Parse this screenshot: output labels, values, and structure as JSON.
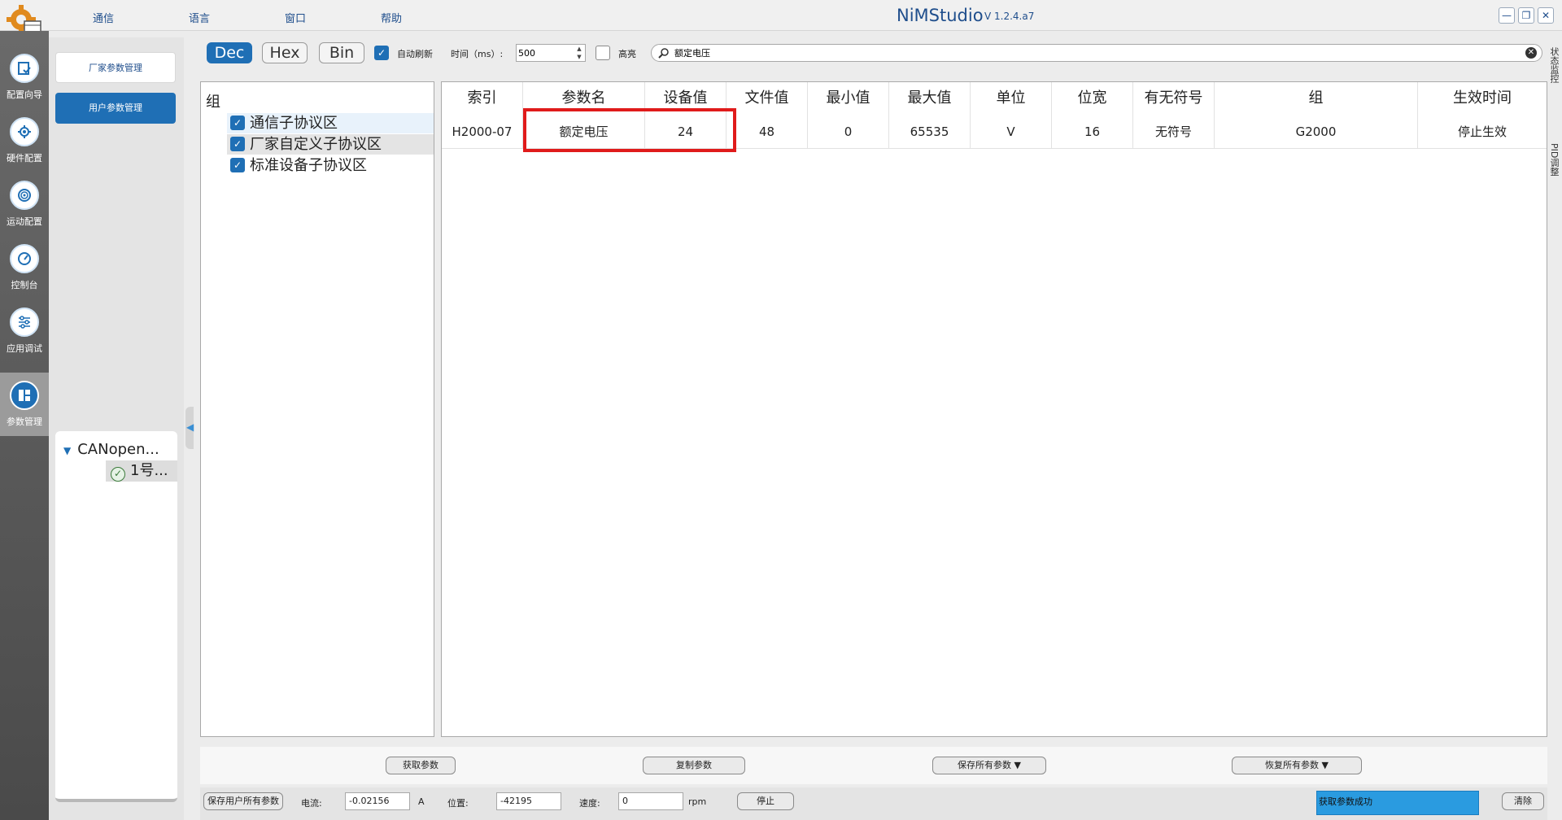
{
  "window": {
    "title": "NiMStudio",
    "version": "V 1.2.4.a7",
    "menus": [
      "通信",
      "语言",
      "窗口",
      "帮助"
    ]
  },
  "nav": [
    {
      "label": "配置向导",
      "icon": "config-wizard-icon"
    },
    {
      "label": "硬件配置",
      "icon": "hardware-config-icon"
    },
    {
      "label": "运动配置",
      "icon": "motion-config-icon"
    },
    {
      "label": "控制台",
      "icon": "console-gauge-icon"
    },
    {
      "label": "应用调试",
      "icon": "app-debug-sliders-icon"
    },
    {
      "label": "参数管理",
      "icon": "param-manage-icon",
      "active": true
    }
  ],
  "sidepanel": {
    "vendor_params": "厂家参数管理",
    "user_params": "用户参数管理",
    "tree_root": "CANopen...",
    "tree_child": "1号..."
  },
  "toolbar": {
    "bases": [
      "Dec",
      "Hex",
      "Bin"
    ],
    "active_base": "Dec",
    "auto_refresh": "自动刷新",
    "auto_refresh_checked": true,
    "time_label": "时间（ms）:",
    "time_value": "500",
    "highlight": "高亮",
    "highlight_checked": false,
    "search_value": "额定电压"
  },
  "right_tabs": [
    "状态监控",
    "PID调整"
  ],
  "groups": {
    "title": "组",
    "items": [
      {
        "label": "通信子协议区",
        "checked": true
      },
      {
        "label": "厂家自定义子协议区",
        "checked": true
      },
      {
        "label": "标准设备子协议区",
        "checked": true
      }
    ]
  },
  "table": {
    "columns": [
      "索引",
      "参数名",
      "设备值",
      "文件值",
      "最小值",
      "最大值",
      "单位",
      "位宽",
      "有无符号",
      "组",
      "生效时间"
    ],
    "rows": [
      [
        "H2000-07",
        "额定电压",
        "24",
        "48",
        "0",
        "65535",
        "V",
        "16",
        "无符号",
        "G2000",
        "停止生效"
      ]
    ]
  },
  "actions": {
    "get_params": "获取参数",
    "copy_params": "复制参数",
    "save_all": "保存所有参数",
    "restore_all": "恢复所有参数"
  },
  "status": {
    "save_user_all": "保存用户所有参数",
    "current_label": "电流:",
    "current_value": "-0.02156",
    "current_unit": "A",
    "position_label": "位置:",
    "position_value": "-42195",
    "speed_label": "速度:",
    "speed_value": "0",
    "speed_unit": "rpm",
    "stop": "停止",
    "message": "获取参数成功",
    "clear": "清除"
  },
  "colors": {
    "accent": "#1f6fb5",
    "highlight_border": "#e01b1b",
    "status_msg_bg": "#2a9be0"
  }
}
